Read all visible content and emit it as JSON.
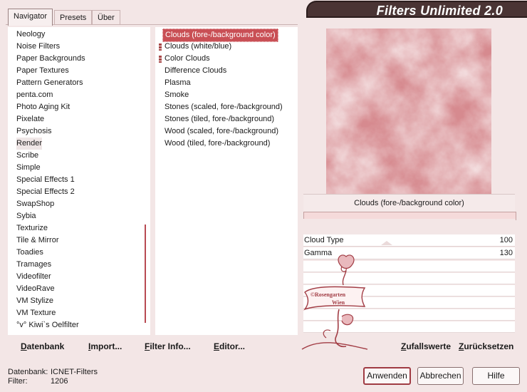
{
  "tabs": [
    {
      "label": "Navigator"
    },
    {
      "label": "Presets"
    },
    {
      "label": "Über"
    }
  ],
  "app_title": "Filters Unlimited 2.0",
  "categories": [
    "Neology",
    "Noise Filters",
    "Paper Backgrounds",
    "Paper Textures",
    "Pattern Generators",
    "penta.com",
    "Photo Aging Kit",
    "Pixelate",
    "Psychosis",
    "Render",
    "Scribe",
    "Simple",
    "Special Effects 1",
    "Special Effects 2",
    "SwapShop",
    "Sybia",
    "Texturize",
    "Tile & Mirror",
    "Toadies",
    "Tramages",
    "Videofilter",
    "VideoRave",
    "VM Stylize",
    "VM Texture",
    "°v° Kiwi`s Oelfilter"
  ],
  "filters": [
    "Clouds (fore-/background color)",
    "Clouds (white/blue)",
    "Color Clouds",
    "Difference Clouds",
    "Plasma",
    "Smoke",
    "Stones (scaled, fore-/background)",
    "Stones (tiled, fore-/background)",
    "Wood (scaled, fore-/background)",
    "Wood (tiled, fore-/background)"
  ],
  "selected_filter_caption": "Clouds (fore-/background color)",
  "params": [
    {
      "label": "Cloud Type",
      "value": "100"
    },
    {
      "label": "Gamma",
      "value": "130"
    }
  ],
  "watermark": {
    "line1": "©Rosengarten",
    "line2": "Wien"
  },
  "bottom_buttons": {
    "database": "Datenbank",
    "import": "Import...",
    "filter_info": "Filter Info...",
    "editor": "Editor...",
    "random": "Zufallswerte",
    "reset": "Zurücksetzen"
  },
  "status": {
    "db_label": "Datenbank:",
    "db_value": "ICNET-Filters",
    "filter_label": "Filter:",
    "filter_value": "1206"
  },
  "dialog_buttons": {
    "apply": "Anwenden",
    "cancel": "Abbrechen",
    "help": "Hilfe"
  },
  "colors": {
    "accent": "#c94f55",
    "background": "#f3e6e6",
    "banner": "#4a3434"
  }
}
